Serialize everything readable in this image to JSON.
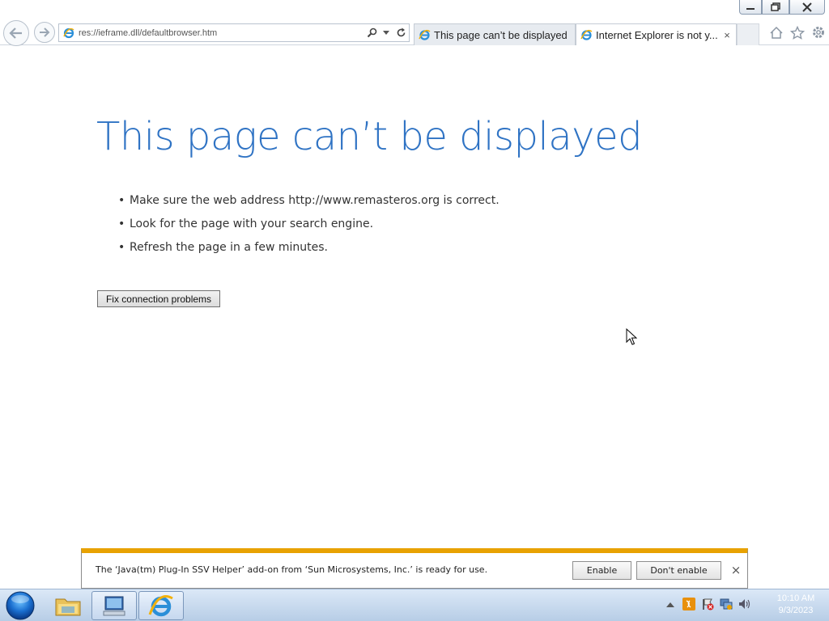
{
  "browser": {
    "address_url": "res://ieframe.dll/defaultbrowser.htm",
    "tabs": [
      {
        "label": "This page can’t be displayed",
        "active": false
      },
      {
        "label": "Internet Explorer is not y...",
        "active": true,
        "close": "×"
      }
    ],
    "icons": {
      "back": "back-arrow-icon",
      "forward": "forward-arrow-icon",
      "search": "search-icon",
      "dropdown": "chevron-down-icon",
      "refresh": "refresh-icon",
      "home": "home-icon",
      "favorites": "star-icon",
      "tools": "gear-icon"
    }
  },
  "page": {
    "title": "This page can’t be displayed",
    "suggestions": [
      "Make sure the web address http://www.remasteros.org is correct.",
      "Look for the page with your search engine.",
      "Refresh the page in a few minutes."
    ],
    "fix_button": "Fix connection problems"
  },
  "notification": {
    "message": "The ‘Java(tm) Plug-In SSV Helper’ add-on from ‘Sun Microsystems, Inc.’ is ready for use.",
    "enable_label": "Enable",
    "dont_enable_label": "Don't enable",
    "close": "×",
    "accent_color": "#e8a202"
  },
  "taskbar": {
    "clock_time": "10:10 AM",
    "clock_date": "9/3/2023"
  },
  "colors": {
    "title_blue": "#2f73c4",
    "taskbar": "#b7cde6"
  }
}
